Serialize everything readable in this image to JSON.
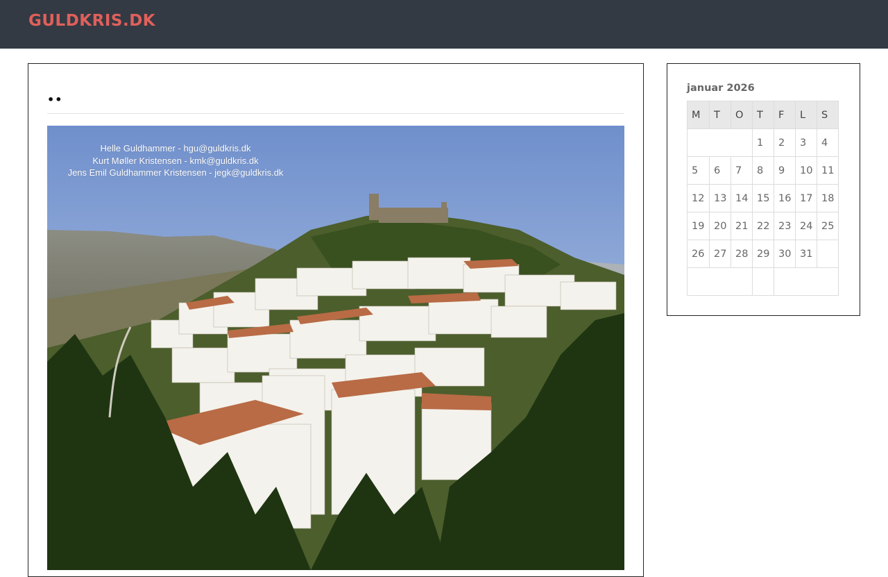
{
  "site": {
    "title": "GULDKRIS.DK"
  },
  "post": {
    "title": "••",
    "image": {
      "caption_lines": [
        "Helle Guldhammer - hgu@guldkris.dk",
        "Kurt Møller Kristensen - kmk@guldkris.dk",
        "Jens Emil Guldhammer Kristensen - jegk@guldkris.dk"
      ]
    }
  },
  "calendar": {
    "caption": "januar 2026",
    "weekdays": [
      "M",
      "T",
      "O",
      "T",
      "F",
      "L",
      "S"
    ],
    "weeks": [
      [
        "",
        "",
        "",
        "1",
        "2",
        "3",
        "4"
      ],
      [
        "5",
        "6",
        "7",
        "8",
        "9",
        "10",
        "11"
      ],
      [
        "12",
        "13",
        "14",
        "15",
        "16",
        "17",
        "18"
      ],
      [
        "19",
        "20",
        "21",
        "22",
        "23",
        "24",
        "25"
      ],
      [
        "26",
        "27",
        "28",
        "29",
        "30",
        "31",
        ""
      ]
    ]
  }
}
